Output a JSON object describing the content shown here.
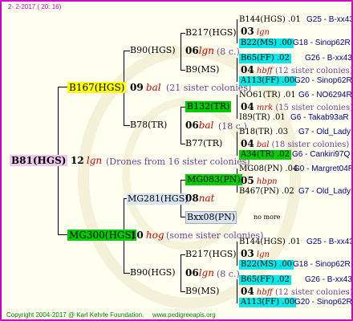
{
  "header": {
    "date": "2- 2-2017 ( 20: 16)"
  },
  "footer": {
    "copyright": "Copyright 2004-2017 @ Karl Kehrle Foundation.",
    "site": "www.pedigreeapis.org"
  },
  "colors": {
    "cyan": "#00e8e8",
    "green": "#00cc00",
    "yellow": "#ffff00",
    "lilac": "#f0c8f0",
    "lightblue": "#d8e4f4",
    "note": "#7040a0",
    "breed": "#00008b",
    "grade": "#d00000",
    "border": "#d000c8"
  },
  "root": {
    "name": "B81(HGS)",
    "year": "12",
    "grade": "lgn",
    "note": "(Drones from 16 sister colonies)"
  },
  "sire": {
    "name": "B167(HGS)",
    "year": "09",
    "grade": "bal",
    "note": "(21 sister colonies)"
  },
  "dam": {
    "name": "MG300(HGS)",
    "year": "10",
    "grade": "hog",
    "note": "(some sister colonies)"
  },
  "s1": {
    "name": "B90(HGS)",
    "year": "06",
    "grade": "lgn",
    "note": "(8 c.)"
  },
  "s2": {
    "name": "B78(TR)",
    "year": "06",
    "grade": "bal",
    "note": "(18 c.)"
  },
  "d1": {
    "name": "MG281(HGS)",
    "year": "08",
    "grade": "nat"
  },
  "d2": {
    "name": "B90(HGS)",
    "year": "06",
    "grade": "lgn",
    "note": "(8 c.)"
  },
  "g1": {
    "name": "B217(HGS)",
    "year": "03",
    "grade": "lgn"
  },
  "g2": {
    "name": "B9(MS)",
    "year": "04",
    "grade": "hbff",
    "note": "(12 sister colonies)"
  },
  "g3": {
    "name": "B132(TR)",
    "year": "04",
    "grade": "mrk",
    "note": "(15 sister colonies)"
  },
  "g4": {
    "name": "B77(TR)",
    "year": "04",
    "grade": "bal",
    "note": "(18 sister colonies)"
  },
  "g5": {
    "name": "MG083(PN)",
    "year": "05",
    "grade": "hbpn"
  },
  "g6": {
    "name": "Bxx08(PN)",
    "note": "no more"
  },
  "g7": {
    "name": "B217(HGS)",
    "year": "03",
    "grade": "lgn"
  },
  "g8": {
    "name": "B9(MS)",
    "year": "04",
    "grade": "hbff",
    "note": "(12 sister colonies)"
  },
  "r1": {
    "name": "B144(HGS) .01",
    "breed": "G25 - B-xx43"
  },
  "r2": {
    "name": "B22(MS) .00",
    "breed": "G18 - Sinop62R"
  },
  "r3": {
    "name": "B65(FF) .02",
    "breed": "G26 - B-xx43"
  },
  "r4": {
    "name": "A113(FF) .00",
    "breed": "G20 - Sinop62R"
  },
  "r5": {
    "name": "NO61(TR) .01",
    "breed": "G6 - NO6294R"
  },
  "r6": {
    "name": "I89(TR) .01",
    "breed": "G6 - Takab93aR"
  },
  "r7": {
    "name": "B18(TR) .03",
    "breed": "G7 - Old_Lady"
  },
  "r8": {
    "name": "A34(TR) .02",
    "breed": "G6 - Cankiri97Q"
  },
  "r9": {
    "name": "MG08(PN) .04",
    "breed": "G0 - Margret04R"
  },
  "r10": {
    "name": "B467(PN) .02",
    "breed": "G7 - Old_Lady"
  },
  "r11": {
    "name": "B144(HGS) .01",
    "breed": "G25 - B-xx43"
  },
  "r12": {
    "name": "B22(MS) .00",
    "breed": "G18 - Sinop62R"
  },
  "r13": {
    "name": "B65(FF) .02",
    "breed": "G26 - B-xx43"
  },
  "r14": {
    "name": "A113(FF) .00",
    "breed": "G20 - Sinop62R"
  }
}
